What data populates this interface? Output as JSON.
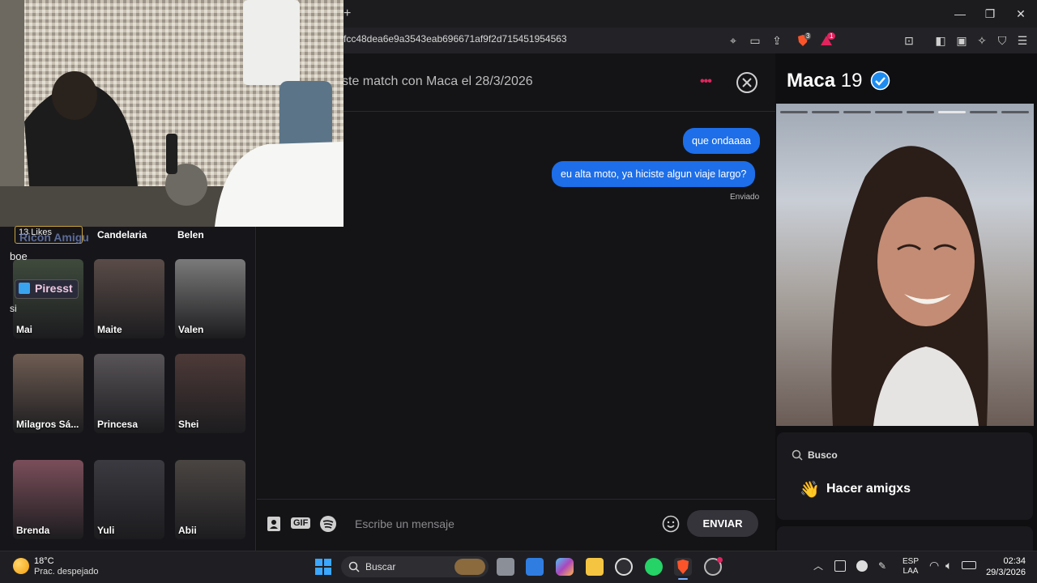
{
  "browser": {
    "new_tab_label": "+",
    "url": "fcc48dea6e9a3543eab696671af9f2d715451954563",
    "shield_badge": "3",
    "alert_badge": "1"
  },
  "window_controls": {
    "minimize": "—",
    "maximize": "❐",
    "close": "✕"
  },
  "webcam_overlay": {
    "likes_badge": "13 Likes",
    "overlay_text_1": "Ricon Amigu",
    "overlay_user_1": "boe",
    "overlay_button": "Piresst",
    "overlay_user_2": "si"
  },
  "sidebar": {
    "row0_names": [
      "Candelaria",
      "Belen"
    ],
    "cards": [
      {
        "name": "Mai",
        "color": "#3f4a3c"
      },
      {
        "name": "Maite",
        "color": "#5a4c48"
      },
      {
        "name": "Valen",
        "color": "#7a7a7a"
      },
      {
        "name": "Milagros Sá...",
        "color": "#6e5c52"
      },
      {
        "name": "Princesa",
        "color": "#585458"
      },
      {
        "name": "Shei",
        "color": "#4d3a38"
      },
      {
        "name": "Brenda",
        "color": "#7a4e5a"
      },
      {
        "name": "Yuli",
        "color": "#3a3a40"
      },
      {
        "name": "Abii",
        "color": "#4a4542"
      }
    ]
  },
  "chat": {
    "match_text": "ste match con Maca el 28/3/2026",
    "more_icon": "•••",
    "messages": [
      {
        "text": "que ondaaaa"
      },
      {
        "text": "eu alta moto, ya hiciste algun viaje largo?"
      }
    ],
    "sent_status": "Enviado",
    "composer": {
      "placeholder": "Escribe un mensaje",
      "gif_label": "GIF",
      "send_label": "ENVIAR"
    }
  },
  "profile": {
    "name": "Maca",
    "age": "19",
    "busco_label": "Busco",
    "intent_emoji": "👋",
    "intent_label": "Hacer amigxs"
  },
  "taskbar": {
    "weather_temp": "18°C",
    "weather_desc": "Prac. despejado",
    "search_label": "Buscar",
    "lang_line1": "ESP",
    "lang_line2": "LAA",
    "time": "02:34",
    "date": "29/3/2026"
  },
  "colors": {
    "accent_blue": "#1d6ee8",
    "dots_pink": "#e0245e",
    "verified_blue": "#1d8cf0"
  }
}
